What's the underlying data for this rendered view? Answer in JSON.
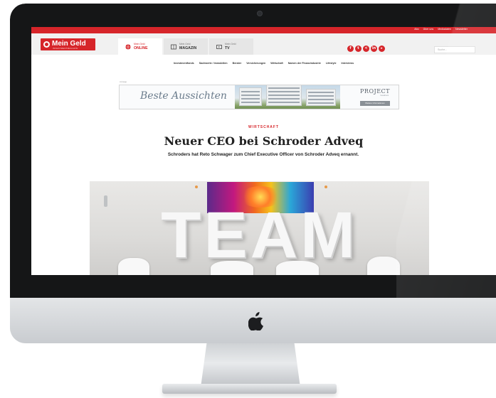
{
  "device": {
    "type": "iMac"
  },
  "site": {
    "logo_text": "Mein Geld",
    "logo_subtext": "INVESTMENTMAGAZIN",
    "top_links": [
      "Abo",
      "Über uns",
      "Mediadaten",
      "Newsletter"
    ],
    "tabs": [
      {
        "small": "Mein Geld",
        "big": "ONLINE",
        "active": true
      },
      {
        "small": "Mein Geld",
        "big": "MAGAZIN",
        "active": false
      },
      {
        "small": "Mein Geld",
        "big": "TV",
        "active": false
      }
    ],
    "social_icons": [
      "facebook-icon",
      "twitter-icon",
      "share-icon",
      "linkedin-icon",
      "youtube-icon"
    ],
    "search_placeholder": "Suche...",
    "categories": [
      "Investmentfonds",
      "Sachwerte / Immobilien",
      "Berater",
      "Versicherungen",
      "Wirtschaft",
      "Namen der Finanzindustrie",
      "Lifestyle",
      "Interviews"
    ],
    "brand_color": "#d6252a"
  },
  "ad": {
    "label": "Anzeige",
    "headline": "Beste Aussichten",
    "brand": "PROJECT",
    "brand_sub": "Investment",
    "cta": "Weitere Informationen"
  },
  "article": {
    "kicker": "WIRTSCHAFT",
    "title": "Neuer CEO bei Schroder Adveq",
    "teaser": "Schroders hat Reto Schwager zum Chief Executive Officer von Schroder Adveq ernannt.",
    "image_text": "TEAM"
  }
}
